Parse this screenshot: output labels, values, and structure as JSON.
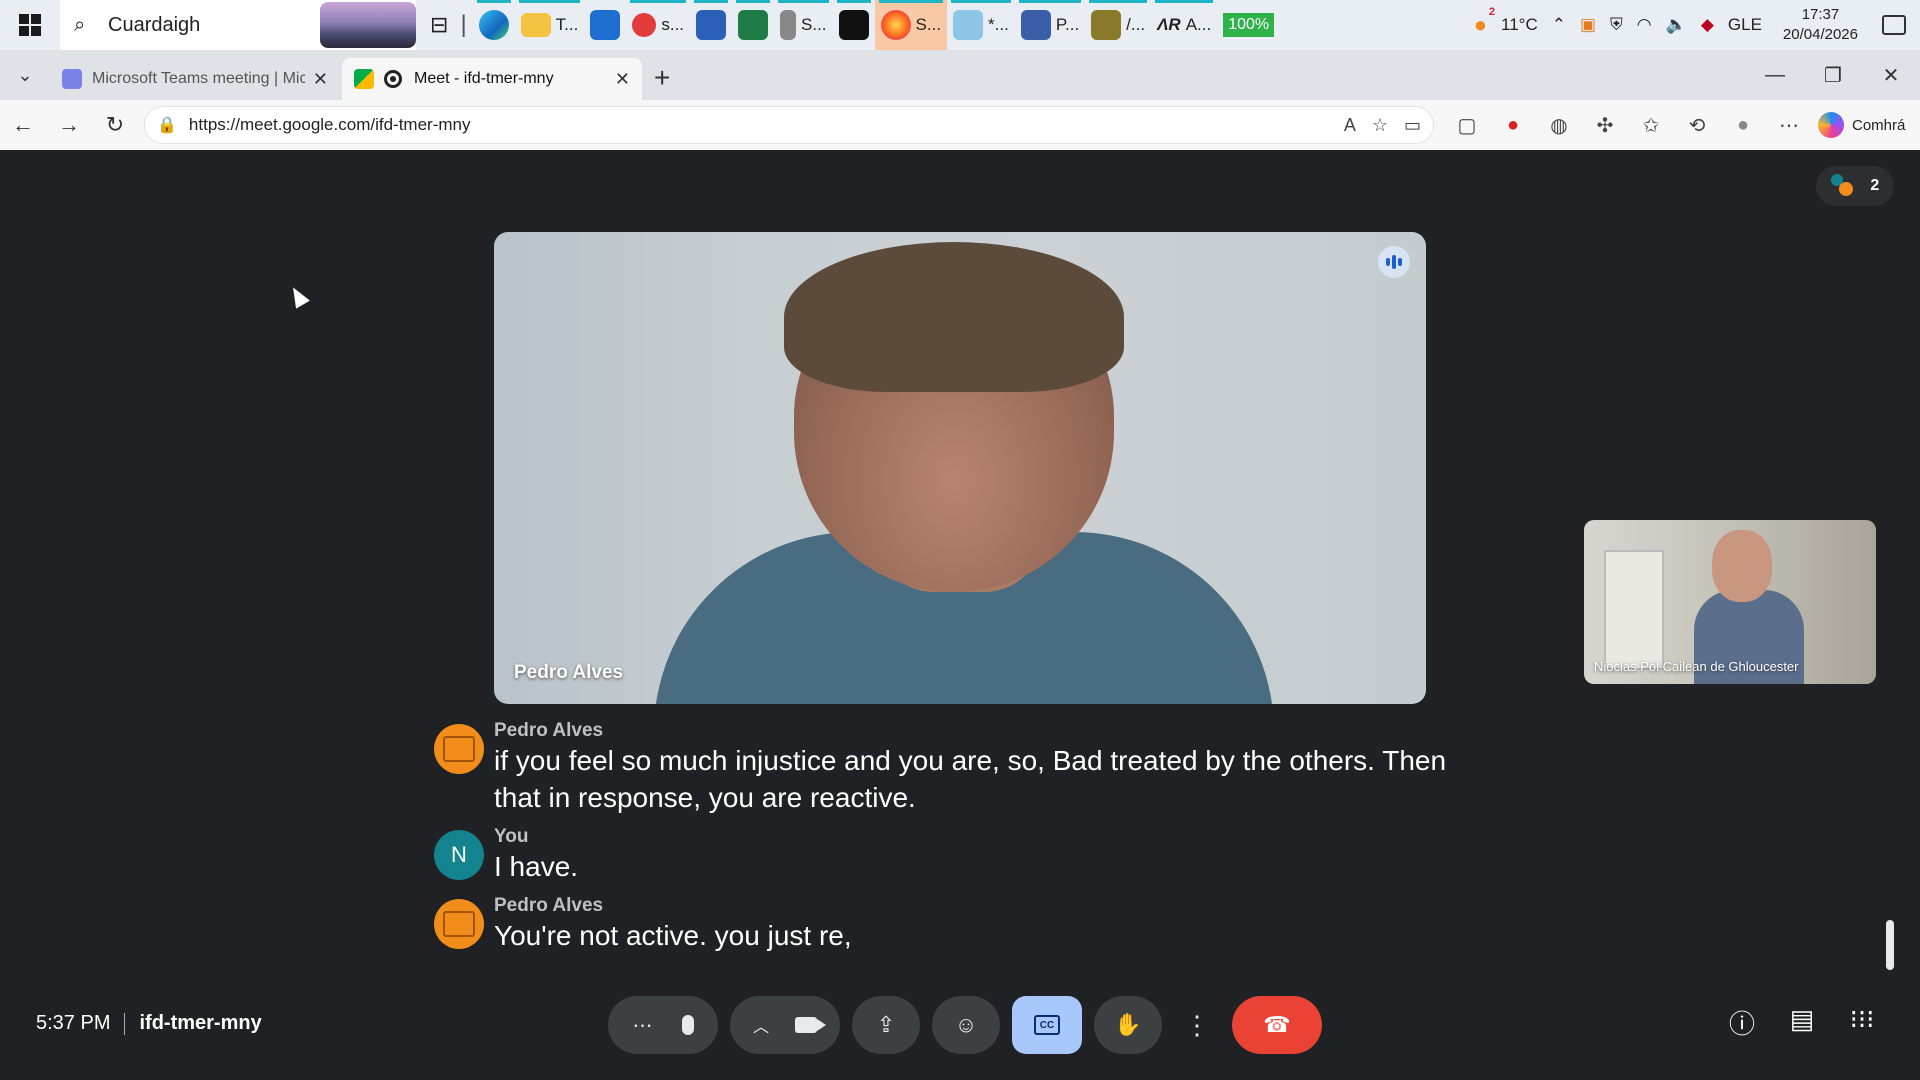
{
  "taskbar": {
    "search_text": "Cuardaigh",
    "items": [
      {
        "label": "",
        "icon": "task-view-icon"
      },
      {
        "label": "",
        "icon": "edge-icon"
      },
      {
        "label": "T...",
        "icon": "file-explorer-icon"
      },
      {
        "label": "",
        "icon": "store-icon"
      },
      {
        "label": "s...",
        "icon": "app-icon"
      },
      {
        "label": "",
        "icon": "word-icon"
      },
      {
        "label": "",
        "icon": "excel-icon"
      },
      {
        "label": "S...",
        "icon": "microphone-app-icon"
      },
      {
        "label": "",
        "icon": "webex-icon"
      },
      {
        "label": "S...",
        "icon": "firefox-icon"
      },
      {
        "label": "*...",
        "icon": "notepad-icon"
      },
      {
        "label": "P...",
        "icon": "remote-desktop-icon"
      },
      {
        "label": "/...",
        "icon": "m-app-icon"
      },
      {
        "label": "A...",
        "icon": "ar-app-icon"
      }
    ],
    "battery_label": "100%",
    "weather_badge": "2",
    "temperature": "11°C",
    "language": "GLE",
    "time": "17:37",
    "date": "20/04/2026"
  },
  "browser": {
    "tabs": [
      {
        "title": "Microsoft Teams meeting | Micros",
        "active": false
      },
      {
        "title": "Meet - ifd-tmer-mny",
        "active": true
      }
    ],
    "url": "https://meet.google.com/ifd-tmer-mny",
    "copilot_label": "Comhrá"
  },
  "meet": {
    "participant_count": "2",
    "main_speaker_name": "Pedro Alves",
    "self_tile_name": "Nioclás Pól Cailean de Ghloucester",
    "captions": [
      {
        "speaker": "Pedro Alves",
        "avatar": "orange-logo",
        "text": "if you feel so much injustice and you are, so, Bad treated by the others. Then that in response, you are reactive."
      },
      {
        "speaker": "You",
        "avatar": "N",
        "text": "I have."
      },
      {
        "speaker": "Pedro Alves",
        "avatar": "orange-logo",
        "text": "You're not active. you just re,"
      }
    ],
    "time": "5:37 PM",
    "meeting_code": "ifd-tmer-mny",
    "colors": {
      "leave": "#ea4335",
      "captions_active": "#a8c7fa",
      "background": "#202124"
    }
  }
}
